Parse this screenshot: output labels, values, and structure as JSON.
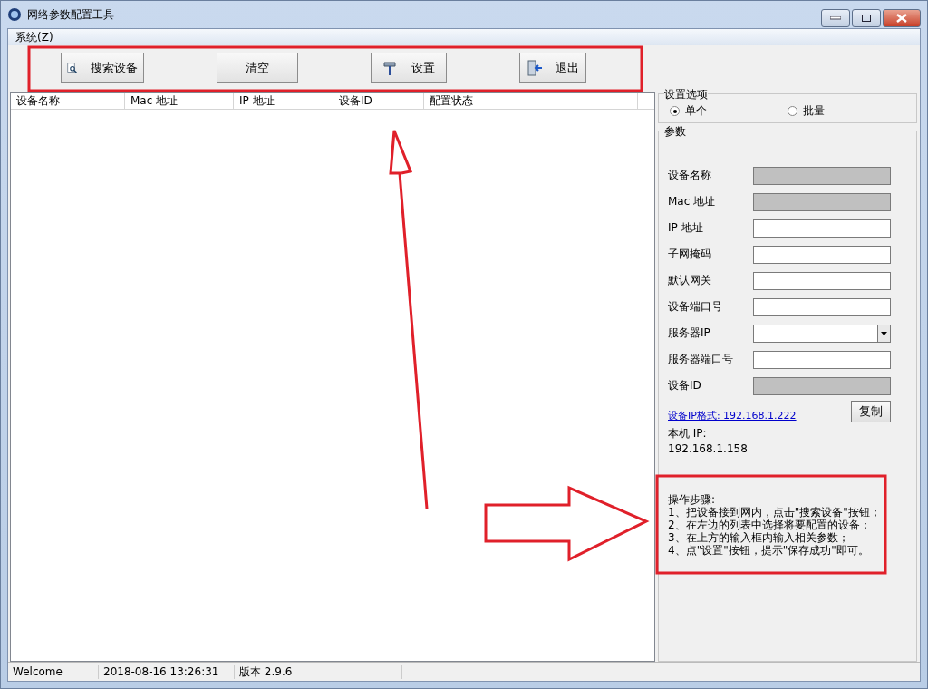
{
  "window": {
    "title": "网络参数配置工具"
  },
  "menu": [
    {
      "label": "系统(Z)"
    }
  ],
  "toolbar": [
    {
      "label": "搜索设备"
    },
    {
      "label": "清空"
    },
    {
      "label": "设置"
    },
    {
      "label": "退出"
    }
  ],
  "table": {
    "columns": [
      "设备名称",
      "Mac 地址",
      "IP 地址",
      "设备ID",
      "配置状态"
    ]
  },
  "options": {
    "title": "设置选项",
    "radios": [
      {
        "label": "单个",
        "selected": true
      },
      {
        "label": "批量",
        "selected": false
      }
    ]
  },
  "params": {
    "title": "参数",
    "fields": [
      {
        "label": "设备名称",
        "kind": "readonly"
      },
      {
        "label": "Mac 地址",
        "kind": "readonly"
      },
      {
        "label": "IP 地址",
        "kind": "text"
      },
      {
        "label": "子网掩码",
        "kind": "text"
      },
      {
        "label": "默认网关",
        "kind": "text"
      },
      {
        "label": "设备端口号",
        "kind": "text"
      },
      {
        "label": "服务器IP",
        "kind": "combo"
      },
      {
        "label": "服务器端口号",
        "kind": "text"
      },
      {
        "label": "设备ID",
        "kind": "readonly"
      }
    ],
    "copy_button": "复制",
    "ip_format_link": "设备IP格式: 192.168.1.222",
    "local_ip_label": "本机 IP:",
    "local_ip": "192.168.1.158",
    "steps": [
      "操作步骤:",
      "1、把设备接到网内，点击\"搜索设备\"按钮；",
      "2、在左边的列表中选择将要配置的设备；",
      "3、在上方的输入框内输入相关参数；",
      "4、点\"设置\"按钮，提示\"保存成功\"即可。"
    ]
  },
  "status_bar": [
    "Welcome",
    "2018-08-16 13:26:31",
    "版本 2.9.6"
  ]
}
